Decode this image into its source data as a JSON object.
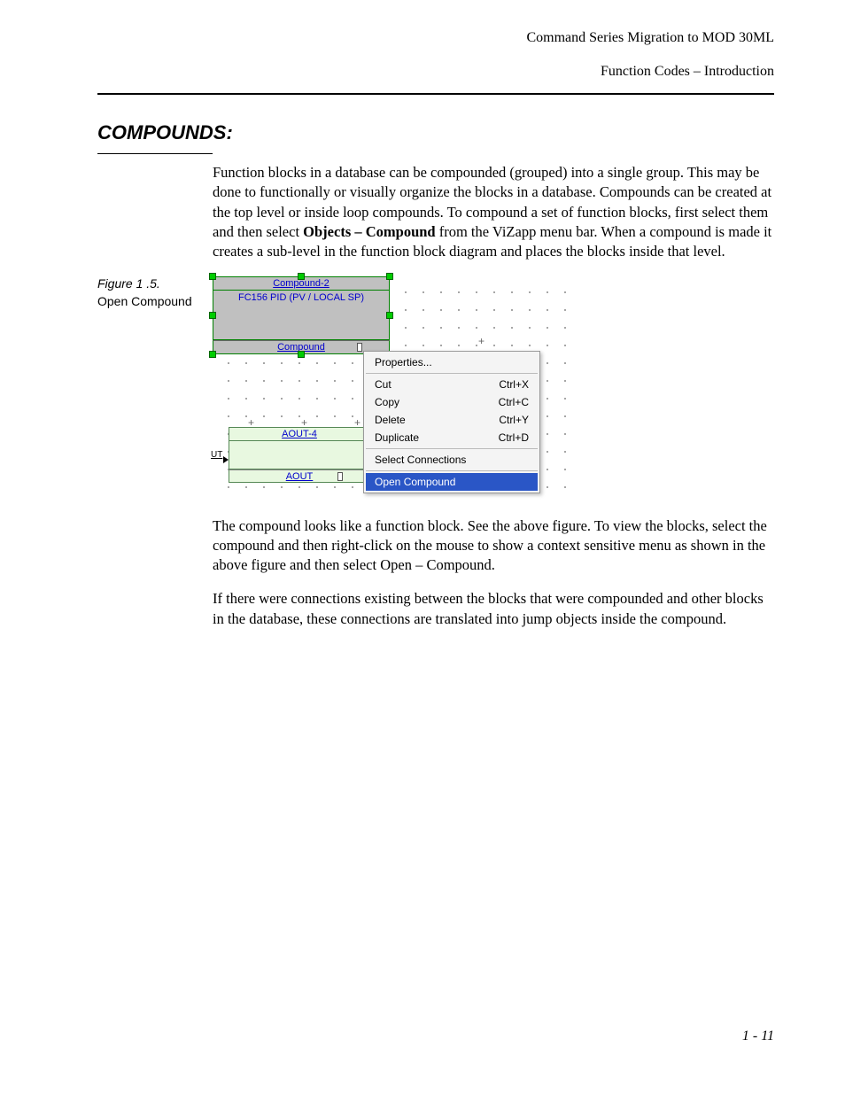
{
  "header": {
    "line1": "Command Series Migration to MOD 30ML",
    "line2": "Function Codes – Introduction"
  },
  "section_title": "COMPOUNDS:",
  "paragraphs": {
    "p1a": "Function blocks in a database can be compounded (grouped) into a single group. This may be done to functionally or visually organize the blocks in a database. Compounds can be created at the top level or inside loop compounds.  To compound a set of function blocks, first select them and then select ",
    "p1b_bold": "Objects – Compound",
    "p1c": " from the ViZapp menu bar. When a compound is made it creates a sub-level in the function block diagram and places the blocks inside that level.",
    "p2": "The compound looks like a function block. See the above figure. To view the blocks, select the compound and then right-click on the mouse to show a context sensitive menu as shown in the above figure and then select Open – Compound.",
    "p3": "If there were connections existing between the blocks that were compounded and other blocks in the database, these connections are translated into jump objects inside the compound."
  },
  "figure": {
    "label": "Figure 1 .5.",
    "caption": "Open Compound",
    "compound_title": "Compound-2",
    "compound_subtitle": "FC156 PID (PV / LOCAL SP)",
    "compound_footer": "Compound",
    "aout_title": "AOUT-4",
    "aout_footer": "AOUT",
    "ut_label": "UT"
  },
  "menu": {
    "properties": "Properties...",
    "cut": {
      "label": "Cut",
      "shortcut": "Ctrl+X"
    },
    "copy": {
      "label": "Copy",
      "shortcut": "Ctrl+C"
    },
    "delete": {
      "label": "Delete",
      "shortcut": "Ctrl+Y"
    },
    "duplicate": {
      "label": "Duplicate",
      "shortcut": "Ctrl+D"
    },
    "select_connections": "Select Connections",
    "open_compound": "Open Compound"
  },
  "page_number": "1 - 11"
}
